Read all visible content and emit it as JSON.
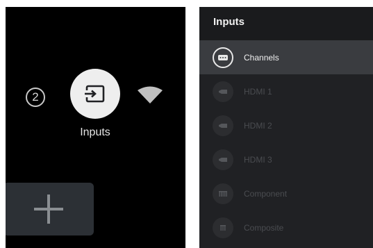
{
  "home_row": {
    "notification_count": "2",
    "inputs_label": "Inputs"
  },
  "inputs_menu": {
    "title": "Inputs",
    "items": [
      {
        "label": "Channels",
        "icon": "channels-icon"
      },
      {
        "label": "HDMI 1",
        "icon": "hdmi-icon"
      },
      {
        "label": "HDMI 2",
        "icon": "hdmi-icon"
      },
      {
        "label": "HDMI 3",
        "icon": "hdmi-icon"
      },
      {
        "label": "Component",
        "icon": "component-icon"
      },
      {
        "label": "Composite",
        "icon": "composite-icon"
      }
    ]
  },
  "colors": {
    "background": "#000000",
    "menu_background": "#202124",
    "selected_row": "#3a3c40",
    "inputs_tile": "#eeeeee"
  }
}
